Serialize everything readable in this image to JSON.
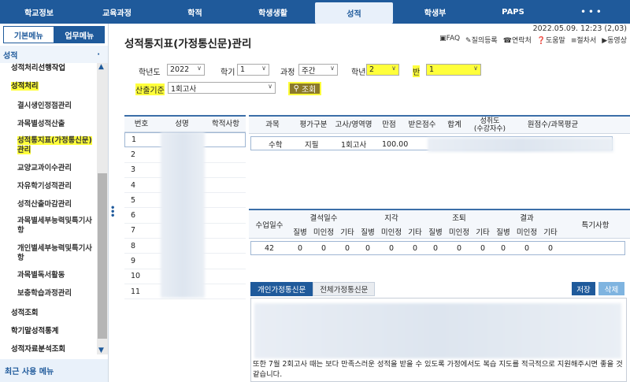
{
  "topnav": [
    "학교정보",
    "교육과정",
    "학적",
    "학생생활",
    "성적",
    "학생부",
    "PAPS",
    "• • •"
  ],
  "sidebar": {
    "tab_basic": "기본메뉴",
    "tab_work": "업무메뉴",
    "section": "성적",
    "section_marker": "·",
    "items": [
      {
        "label": "성적처리선행작업",
        "level": 1
      },
      {
        "label": "성적처리",
        "level": 1,
        "highlight": true
      },
      {
        "label": "결시생인정점관리",
        "level": 2
      },
      {
        "label": "과목별성적산출",
        "level": 2
      },
      {
        "label": "성적통지표(가정통신문)관리",
        "level": 2,
        "highlight": true
      },
      {
        "label": "교양교과이수관리",
        "level": 2
      },
      {
        "label": "자유학기성적관리",
        "level": 2
      },
      {
        "label": "성적산출마감관리",
        "level": 2
      },
      {
        "label": "과목별세부능력및특기사항",
        "level": 2
      },
      {
        "label": "개인별세부능력및특기사항",
        "level": 2
      },
      {
        "label": "과목별독서활동",
        "level": 2
      },
      {
        "label": "보충학습과정관리",
        "level": 2
      },
      {
        "label": "성적조회",
        "level": 1
      },
      {
        "label": "학기말성적통계",
        "level": 1
      },
      {
        "label": "성적자료분석조회",
        "level": 1
      }
    ],
    "recent": "최근 사용 메뉴"
  },
  "header": {
    "title": "성적통지표(가정통신문)관리",
    "datetime": "2022.05.09. 12:23 (2,03)",
    "links": [
      "FAQ",
      "질의등록",
      "연락처",
      "도움말",
      "절차서",
      "동영상"
    ]
  },
  "search": {
    "year_label": "학년도",
    "year": "2022",
    "term_label": "학기",
    "term": "1",
    "course_label": "과정",
    "course": "주간",
    "grade_label": "학년",
    "grade": "2",
    "class_label": "반",
    "class": "1",
    "basis_label": "산출기준",
    "basis": "1회고사",
    "search_btn": "조회"
  },
  "students": {
    "headers": [
      "번호",
      "성명",
      "학적사항"
    ],
    "numbers": [
      "1",
      "2",
      "3",
      "4",
      "5",
      "6",
      "7",
      "8",
      "9",
      "10",
      "11"
    ]
  },
  "grades": {
    "headers": [
      "과목",
      "평가구분",
      "고사/영역명",
      "만점",
      "받은점수",
      "합계",
      "성취도\n(수강자수)",
      "원점수/과목평균"
    ],
    "row": {
      "subject": "수학",
      "type": "지필",
      "exam": "1회고사",
      "max": "100.00"
    }
  },
  "attendance": {
    "days_label": "수업일수",
    "groups": [
      "결석일수",
      "지각",
      "조퇴",
      "결과"
    ],
    "sub": [
      "질병",
      "미인정",
      "기타"
    ],
    "special_label": "특기사항",
    "days": "42",
    "values": [
      "0",
      "0",
      "0",
      "0",
      "0",
      "0",
      "0",
      "0",
      "0",
      "0",
      "0",
      "0"
    ]
  },
  "tabs": {
    "personal": "개인가정통신문",
    "all": "전체가정통신문"
  },
  "buttons": {
    "save": "저장",
    "delete": "삭제"
  },
  "letter": {
    "text": "또한 7월 2회고사 때는 보다 만족스러운 성적을 받을 수 있도록 가정에서도 복습 지도를 적극적으로 지원해주시면 좋을 것 같습니다."
  }
}
